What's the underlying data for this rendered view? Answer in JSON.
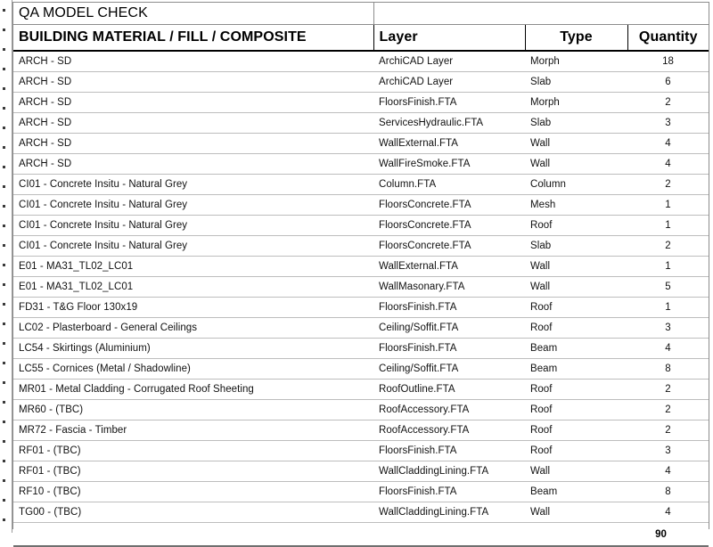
{
  "document": {
    "title": "QA MODEL CHECK"
  },
  "columns": {
    "material": "BUILDING MATERIAL / FILL / COMPOSITE",
    "layer": "Layer",
    "type": "Type",
    "quantity": "Quantity"
  },
  "rows": [
    {
      "material": "ARCH - SD",
      "layer": "ArchiCAD Layer",
      "type": "Morph",
      "quantity": "18"
    },
    {
      "material": "ARCH - SD",
      "layer": "ArchiCAD Layer",
      "type": "Slab",
      "quantity": "6"
    },
    {
      "material": "ARCH - SD",
      "layer": "FloorsFinish.FTA",
      "type": "Morph",
      "quantity": "2"
    },
    {
      "material": "ARCH - SD",
      "layer": "ServicesHydraulic.FTA",
      "type": "Slab",
      "quantity": "3"
    },
    {
      "material": "ARCH - SD",
      "layer": "WallExternal.FTA",
      "type": "Wall",
      "quantity": "4"
    },
    {
      "material": "ARCH - SD",
      "layer": "WallFireSmoke.FTA",
      "type": "Wall",
      "quantity": "4"
    },
    {
      "material": "CI01 - Concrete Insitu - Natural Grey",
      "layer": "Column.FTA",
      "type": "Column",
      "quantity": "2"
    },
    {
      "material": "CI01 - Concrete Insitu - Natural Grey",
      "layer": "FloorsConcrete.FTA",
      "type": "Mesh",
      "quantity": "1"
    },
    {
      "material": "CI01 - Concrete Insitu - Natural Grey",
      "layer": "FloorsConcrete.FTA",
      "type": "Roof",
      "quantity": "1"
    },
    {
      "material": "CI01 - Concrete Insitu - Natural Grey",
      "layer": "FloorsConcrete.FTA",
      "type": "Slab",
      "quantity": "2"
    },
    {
      "material": "E01 - MA31_TL02_LC01",
      "layer": "WallExternal.FTA",
      "type": "Wall",
      "quantity": "1"
    },
    {
      "material": "E01 - MA31_TL02_LC01",
      "layer": "WallMasonary.FTA",
      "type": "Wall",
      "quantity": "5"
    },
    {
      "material": "FD31 - T&G Floor 130x19",
      "layer": "FloorsFinish.FTA",
      "type": "Roof",
      "quantity": "1"
    },
    {
      "material": "LC02 - Plasterboard - General Ceilings",
      "layer": "Ceiling/Soffit.FTA",
      "type": "Roof",
      "quantity": "3"
    },
    {
      "material": "LC54 - Skirtings (Aluminium)",
      "layer": "FloorsFinish.FTA",
      "type": "Beam",
      "quantity": "4"
    },
    {
      "material": "LC55 - Cornices (Metal / Shadowline)",
      "layer": "Ceiling/Soffit.FTA",
      "type": "Beam",
      "quantity": "8"
    },
    {
      "material": "MR01 - Metal Cladding - Corrugated Roof Sheeting",
      "layer": "RoofOutline.FTA",
      "type": "Roof",
      "quantity": "2"
    },
    {
      "material": "MR60 - (TBC)",
      "layer": "RoofAccessory.FTA",
      "type": "Roof",
      "quantity": "2"
    },
    {
      "material": "MR72 - Fascia - Timber",
      "layer": "RoofAccessory.FTA",
      "type": "Roof",
      "quantity": "2"
    },
    {
      "material": "RF01 - (TBC)",
      "layer": "FloorsFinish.FTA",
      "type": "Roof",
      "quantity": "3"
    },
    {
      "material": "RF01 - (TBC)",
      "layer": "WallCladdingLining.FTA",
      "type": "Wall",
      "quantity": "4"
    },
    {
      "material": "RF10 - (TBC)",
      "layer": "FloorsFinish.FTA",
      "type": "Beam",
      "quantity": "8"
    },
    {
      "material": "TG00 - (TBC)",
      "layer": "WallCladdingLining.FTA",
      "type": "Wall",
      "quantity": "4"
    }
  ],
  "total": {
    "material": "",
    "layer": "",
    "type": "",
    "quantity": "90"
  }
}
